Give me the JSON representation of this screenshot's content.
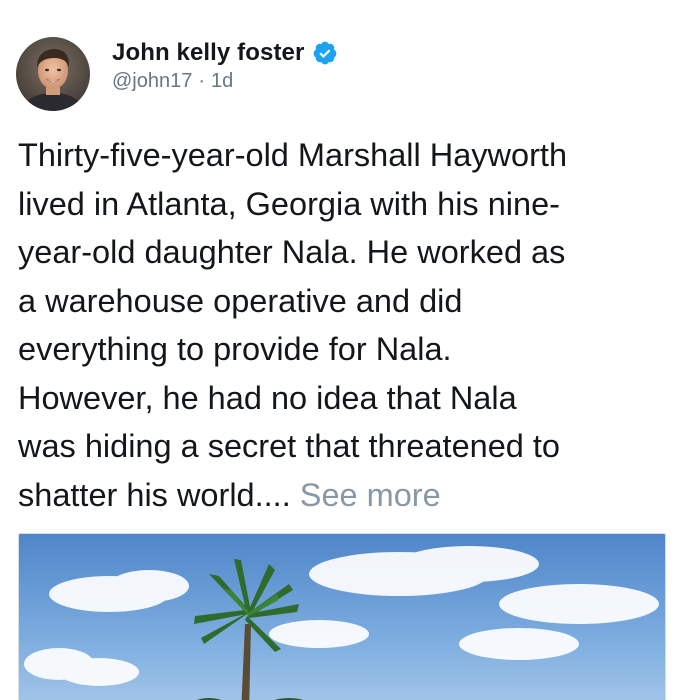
{
  "author": {
    "name": "John kelly foster",
    "handle": "@john17",
    "time_ago": "1d",
    "separator": "·",
    "verified_icon": "verified-badge-icon"
  },
  "tweet": {
    "lines": [
      "Thirty-five-year-old Marshall Hayworth",
      "lived in Atlanta, Georgia with his nine-",
      "year-old daughter Nala. He worked as",
      "a warehouse operative and did",
      "everything to provide for Nala.",
      "However, he had no idea that Nala",
      "was hiding a secret that threatened to",
      "shatter his world...."
    ],
    "see_more": "See more"
  },
  "media": {
    "type": "photo",
    "subject": "palm-tree-sky"
  },
  "colors": {
    "text": "#14171a",
    "secondary": "#657786",
    "see_more": "#8899a6",
    "verified": "#1da1f2"
  }
}
